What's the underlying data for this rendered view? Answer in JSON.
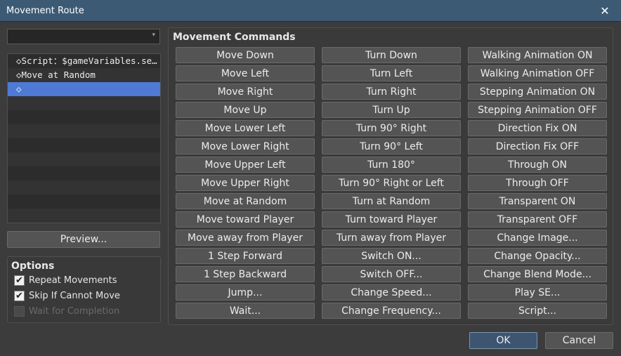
{
  "window": {
    "title": "Movement Route",
    "close_glyph": "✕"
  },
  "target_select": {
    "value": "",
    "arrow_glyph": "▾"
  },
  "route_list": {
    "rows": [
      "◇Script：$gameVariables.setValue(…",
      "◇Move at Random",
      "◇",
      "",
      "",
      "",
      "",
      "",
      "",
      "",
      "",
      ""
    ],
    "selected_index": 2
  },
  "preview_label": "Preview...",
  "options": {
    "title": "Options",
    "repeat": {
      "label": "Repeat Movements",
      "checked": true
    },
    "skip": {
      "label": "Skip If Cannot Move",
      "checked": true
    },
    "wait": {
      "label": "Wait for Completion",
      "checked": false,
      "disabled": true
    }
  },
  "commands": {
    "title": "Movement Commands",
    "buttons": [
      "Move Down",
      "Turn Down",
      "Walking Animation ON",
      "Move Left",
      "Turn Left",
      "Walking Animation OFF",
      "Move Right",
      "Turn Right",
      "Stepping Animation ON",
      "Move Up",
      "Turn Up",
      "Stepping Animation OFF",
      "Move Lower Left",
      "Turn 90° Right",
      "Direction Fix ON",
      "Move Lower Right",
      "Turn 90° Left",
      "Direction Fix OFF",
      "Move Upper Left",
      "Turn 180°",
      "Through ON",
      "Move Upper Right",
      "Turn 90° Right or Left",
      "Through OFF",
      "Move at Random",
      "Turn at Random",
      "Transparent ON",
      "Move toward Player",
      "Turn toward Player",
      "Transparent OFF",
      "Move away from Player",
      "Turn away from Player",
      "Change Image...",
      "1 Step Forward",
      "Switch ON...",
      "Change Opacity...",
      "1 Step Backward",
      "Switch OFF...",
      "Change Blend Mode...",
      "Jump...",
      "Change Speed...",
      "Play SE...",
      "Wait...",
      "Change Frequency...",
      "Script..."
    ]
  },
  "footer": {
    "ok_label": "OK",
    "cancel_label": "Cancel"
  },
  "check_glyph": "✔"
}
